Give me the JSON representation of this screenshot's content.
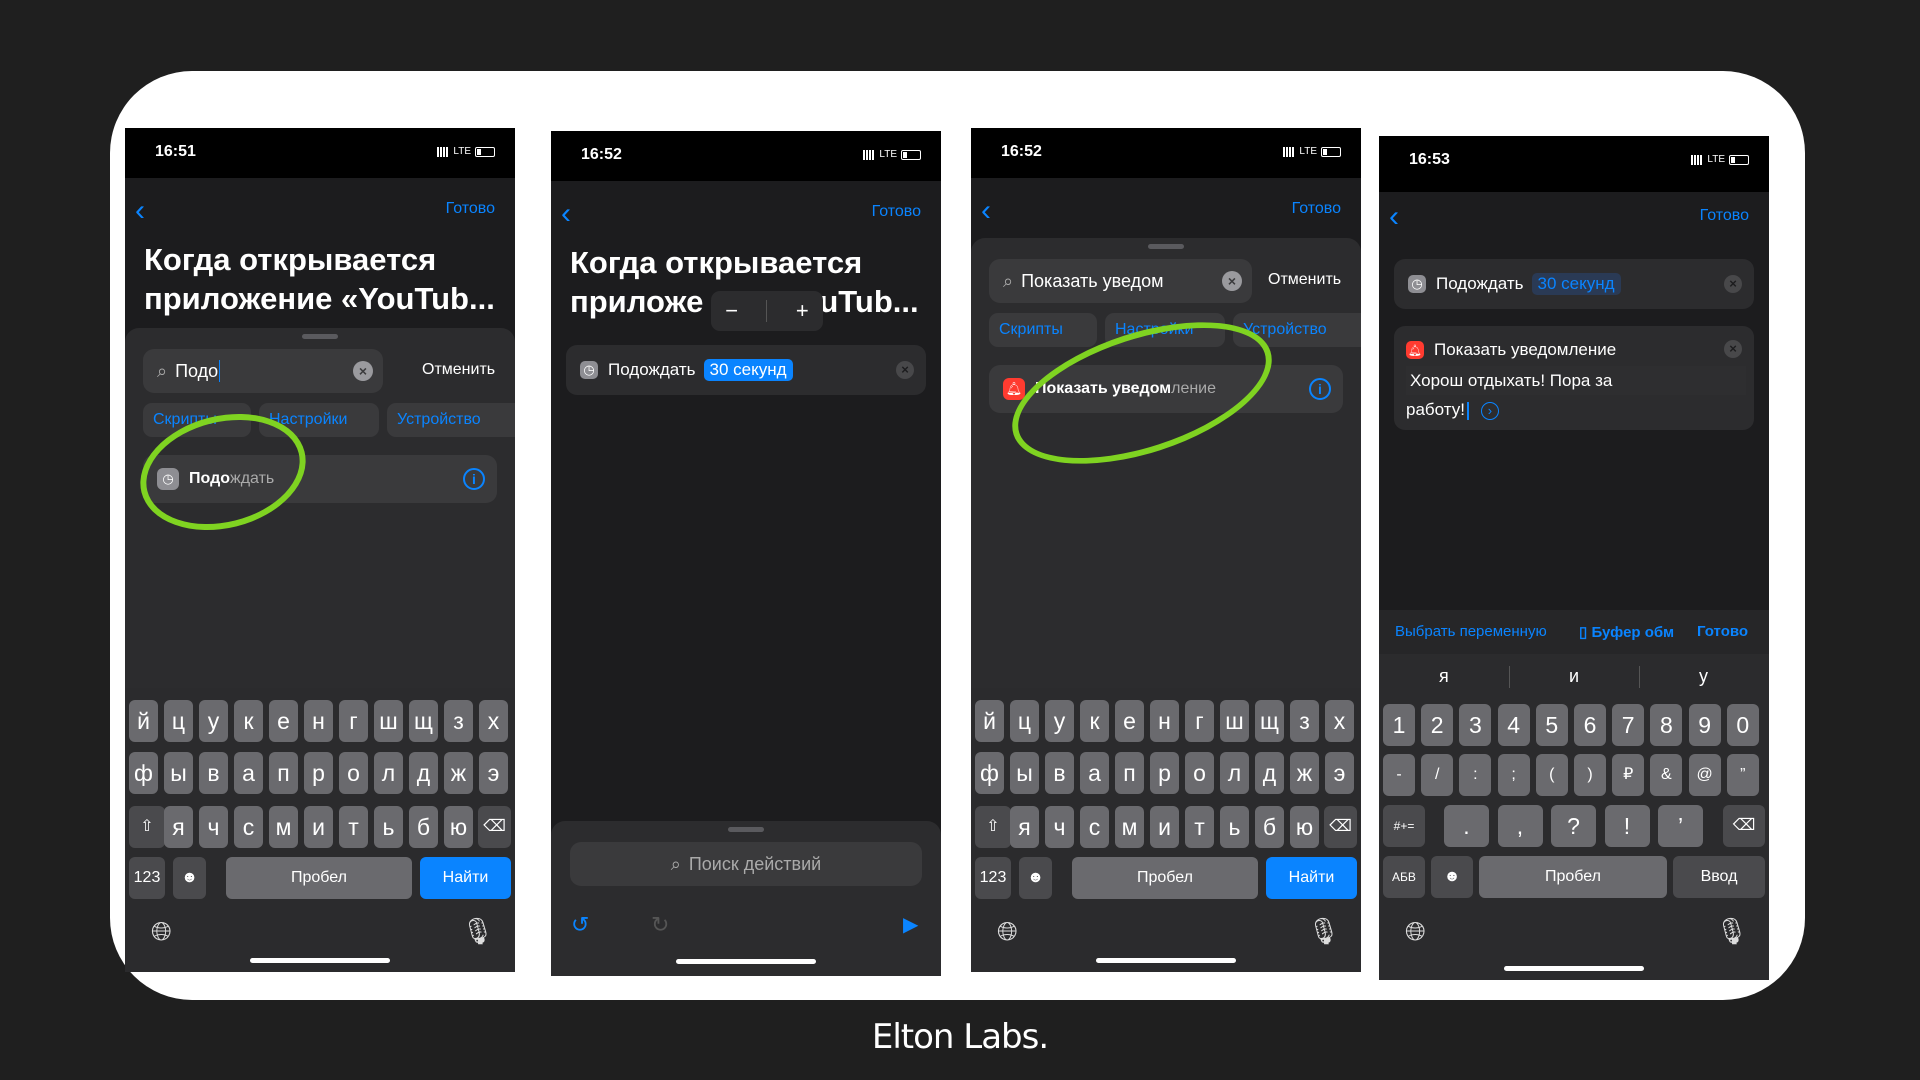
{
  "brand": "Elton Labs.",
  "common": {
    "done": "Готово",
    "cancel": "Отменить",
    "network": "LTE",
    "title_line1": "Когда открывается",
    "title_line2": "приложение «YouTub...",
    "wait_action": "Подождать",
    "wait_value": "30 секунд",
    "space": "Пробел",
    "find": "Найти",
    "num_key": "123"
  },
  "keyboard_rows": [
    [
      "й",
      "ц",
      "у",
      "к",
      "е",
      "н",
      "г",
      "ш",
      "щ",
      "з",
      "х"
    ],
    [
      "ф",
      "ы",
      "в",
      "а",
      "п",
      "р",
      "о",
      "л",
      "д",
      "ж",
      "э"
    ],
    [
      "я",
      "ч",
      "с",
      "м",
      "и",
      "т",
      "ь",
      "б",
      "ю"
    ]
  ],
  "screen1": {
    "time": "16:51",
    "search_value": "Подо",
    "categories": [
      "Скрипты",
      "Настройки",
      "Устройство"
    ],
    "result_match": "Подо",
    "result_rest": "ждать"
  },
  "screen2": {
    "time": "16:52",
    "title_line2a": "приложе",
    "title_line2b": "uTub...",
    "stepper_minus": "−",
    "stepper_plus": "+",
    "search_placeholder": "Поиск действий"
  },
  "screen3": {
    "time": "16:52",
    "search_value": "Показать уведом",
    "categories": [
      "Скрипты",
      "Настройки",
      "Устройство"
    ],
    "result_match": "Показать уведом",
    "result_rest": "ление"
  },
  "screen4": {
    "time": "16:53",
    "notify_action": "Показать уведомление",
    "notify_text_line1": "Хорош отдыхать! Пора за",
    "notify_text_line2": "работу!",
    "toolbar_variable": "Выбрать переменную",
    "toolbar_clipboard": "Буфер обм",
    "suggestions": [
      "я",
      "и",
      "у"
    ],
    "num_row": [
      "1",
      "2",
      "3",
      "4",
      "5",
      "6",
      "7",
      "8",
      "9",
      "0"
    ],
    "sym_row": [
      "-",
      "/",
      ":",
      ";",
      "(",
      ")",
      "₽",
      "&",
      "@",
      "”"
    ],
    "punct_row": [
      ".",
      ",",
      "?",
      "!",
      "’"
    ],
    "more_key": "#+=",
    "abc_key": "АБВ",
    "return_key": "Ввод"
  }
}
